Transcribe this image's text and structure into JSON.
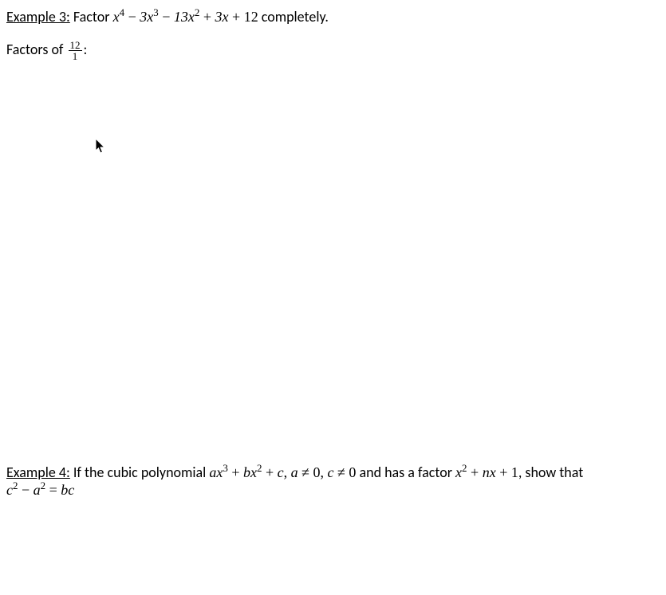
{
  "example3": {
    "heading": "Example 3:",
    "prefix": " Factor ",
    "poly": {
      "t1_coef": "x",
      "t1_exp": "4",
      "op1": " − ",
      "t2_coef": "3x",
      "t2_exp": "3",
      "op2": " − ",
      "t3_coef": "13x",
      "t3_exp": "2",
      "op3": " + ",
      "t4": "3x",
      "op4": " + ",
      "t5": "12"
    },
    "suffix": " completely."
  },
  "factors": {
    "prefix": "Factors of ",
    "num": "12",
    "den": "1",
    "suffix": ":"
  },
  "example4": {
    "heading": "Example 4:",
    "prefix": " If the cubic polynomial ",
    "poly": {
      "a": "ax",
      "a_exp": "3",
      "op1": " + ",
      "b": "bx",
      "b_exp": "2",
      "op2": " + ",
      "c": "c",
      "comma1": ", ",
      "cond1_lhs": "a",
      "ne1": " ≠ ",
      "cond1_rhs": "0",
      "comma2": ", ",
      "cond2_lhs": "c",
      "ne2": " ≠ ",
      "cond2_rhs": "0"
    },
    "mid": " and has a factor ",
    "factor": {
      "x": "x",
      "x_exp": "2",
      "op1": " + ",
      "nx": "nx",
      "op2": " + ",
      "one": "1"
    },
    "suffix": ", show that",
    "line2": {
      "c": "c",
      "c_exp": "2",
      "op1": " − ",
      "a": "a",
      "a_exp": "2",
      "eq": " = ",
      "rhs": "bc"
    }
  }
}
